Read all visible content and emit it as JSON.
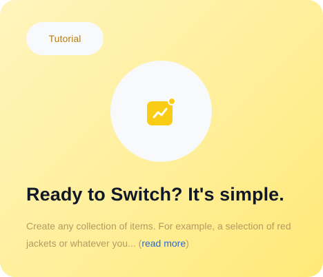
{
  "card": {
    "badge_label": "Tutorial",
    "icon": "trend-chart-notification-icon",
    "title": "Ready to Switch? It's simple.",
    "description": "Create any collection of items. For example, a selection of red jackets or whatever you... ",
    "read_more_open": "(",
    "read_more_label": "read more",
    "read_more_close": ")"
  },
  "colors": {
    "background_start": "#fff4bd",
    "background_end": "#ffe977",
    "badge_text": "#b47d15",
    "icon_tile": "#facc15",
    "title_text": "#111827",
    "description_text": "#b59a63",
    "link": "#2a66d8"
  }
}
